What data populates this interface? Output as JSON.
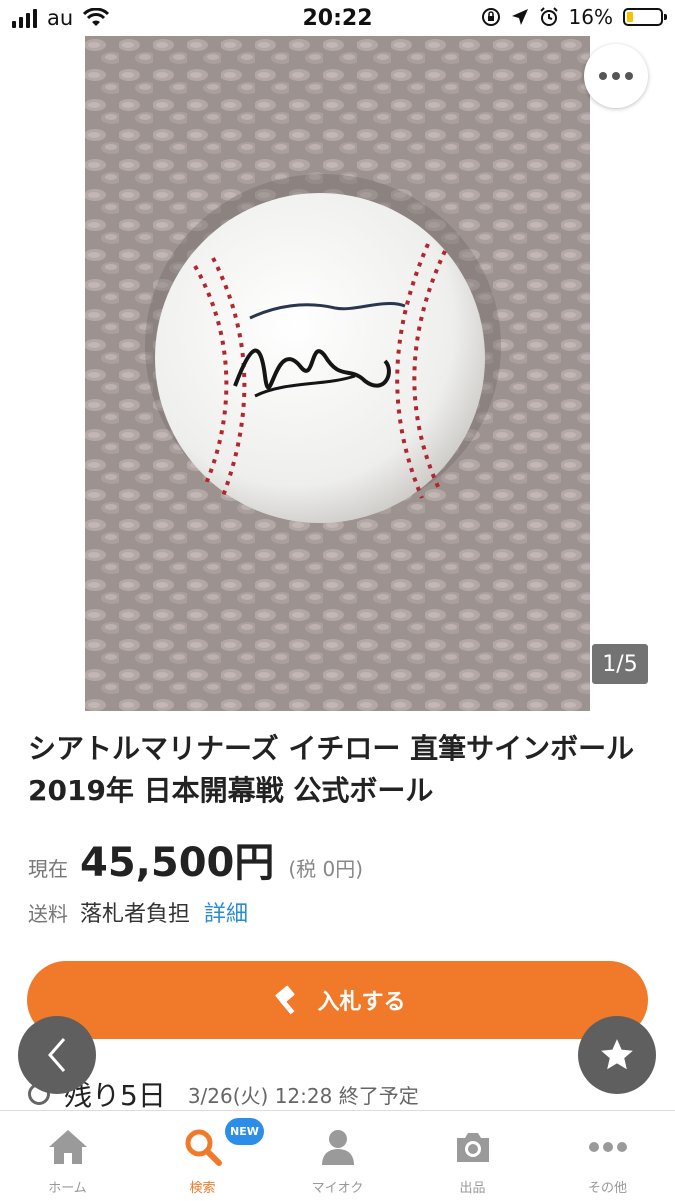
{
  "status_bar": {
    "carrier": "au",
    "time": "20:22",
    "battery": "16%",
    "battery_level": 0.16
  },
  "photo": {
    "description_icon": "baseball-photo",
    "counter": "1/5"
  },
  "item": {
    "title": "シアトルマリナーズ イチロー 直筆サインボール 2019年 日本開幕戦 公式ボール",
    "price_label": "現在",
    "price": "45,500円",
    "tax": "(税 0円)",
    "shipping_label": "送料",
    "shipping_value": "落札者負担",
    "shipping_link": "詳細"
  },
  "bid_button": {
    "label": "入札する",
    "icon": "gavel-icon"
  },
  "remaining": {
    "label": "残り5日",
    "end_date": "3/26(火) 12:28 終了予定"
  },
  "tabs": [
    {
      "label": "ホーム",
      "icon": "home-icon"
    },
    {
      "label": "検索",
      "icon": "search-icon",
      "badge": "NEW"
    },
    {
      "label": "マイオク",
      "icon": "person-icon"
    },
    {
      "label": "出品",
      "icon": "camera-icon"
    },
    {
      "label": "その他",
      "icon": "more-icon"
    }
  ],
  "colors": {
    "accent": "#f07a2a",
    "link": "#2a8bd6",
    "badge": "#2d8ee8",
    "fab": "#5f5f5f"
  }
}
